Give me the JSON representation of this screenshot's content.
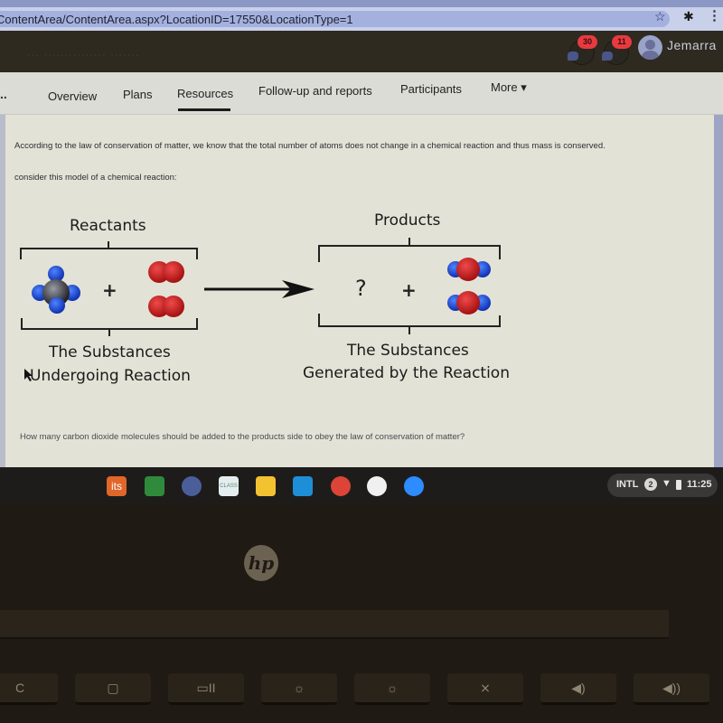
{
  "browser": {
    "url": "ContentArea/ContentArea.aspx?LocationID=17550&LocationType=1",
    "icons": [
      "star-icon",
      "extensions-icon",
      "menu-icon"
    ]
  },
  "header": {
    "faded_text": "...      ...............      .......",
    "notifications": [
      {
        "icon": "notification-bell-icon",
        "count": "30"
      },
      {
        "icon": "chat-icon",
        "count": "11"
      }
    ],
    "user": {
      "name": "Jemarra",
      "icon": "avatar-icon"
    },
    "badge_color": "#e83a3f"
  },
  "nav": {
    "overflow": "..",
    "items": [
      {
        "label": "Overview"
      },
      {
        "label": "Plans"
      },
      {
        "label": "Resources",
        "active": true
      },
      {
        "label": "Follow-up and reports"
      },
      {
        "label": "Participants"
      },
      {
        "label": "More ▾"
      }
    ]
  },
  "content": {
    "intro_1": "According to the law of conservation of matter, we know that the total number of atoms does not change in a chemical reaction and thus mass is conserved.",
    "intro_2": "consider this model of a chemical reaction:",
    "diagram": {
      "reactants_title": "Reactants",
      "products_title": "Products",
      "reactants_caption_1": "The Substances",
      "reactants_caption_2": "Undergoing Reaction",
      "products_caption_1": "The Substances",
      "products_caption_2": "Generated by the Reaction",
      "plus": "+",
      "unknown": "?",
      "colors": {
        "carbon": "#3a3c44",
        "hydrogen": "#1f4fe0",
        "oxygen": "#d42020"
      }
    },
    "question": "How many carbon dioxide molecules should be added to the products side to obey the law of conservation of matter?"
  },
  "taskbar": {
    "apps": [
      {
        "name": "its",
        "label": "its",
        "color": "#e0662a"
      },
      {
        "name": "google-classroom",
        "label": "",
        "color": "#2f8a3c"
      },
      {
        "name": "camera",
        "label": "",
        "color": "#4a5f9a"
      },
      {
        "name": "class",
        "label": "CLASS",
        "color": "#e4eef0"
      },
      {
        "name": "google-drive",
        "label": "",
        "color": "#f2c230"
      },
      {
        "name": "screencastify",
        "label": "",
        "color": "#1e8ed6"
      },
      {
        "name": "chrome",
        "label": "",
        "color": "#db4437"
      },
      {
        "name": "play-store",
        "label": "",
        "color": "#f0f0f0"
      },
      {
        "name": "zoom",
        "label": "",
        "color": "#2d8cff"
      }
    ],
    "tray": {
      "input": "INTL",
      "notifications": "2",
      "time": "11:25"
    }
  },
  "device": {
    "logo": "hp",
    "keys": [
      "C",
      "▢",
      "▭II",
      "☼",
      "☼",
      "⨯",
      "◀)",
      "◀))"
    ]
  }
}
